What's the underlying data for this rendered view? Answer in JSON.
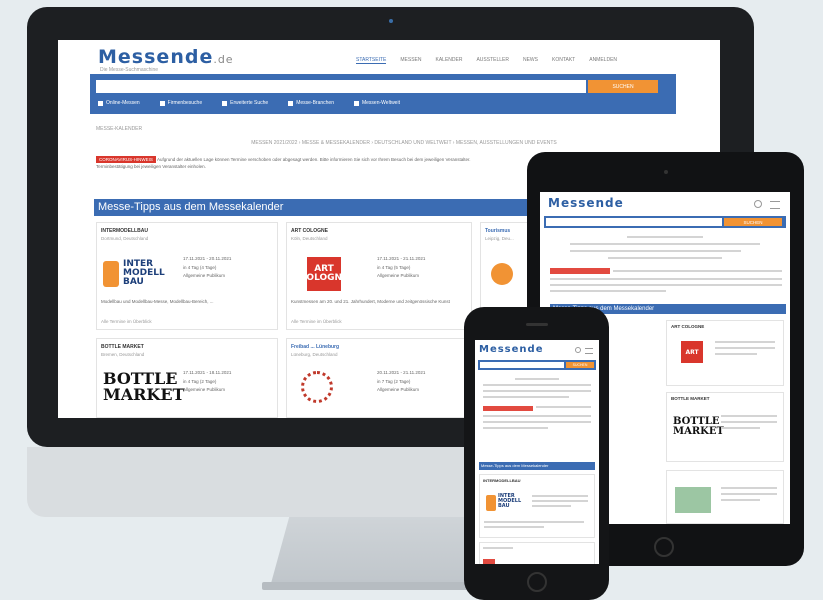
{
  "brand": {
    "logo_main": "Messe",
    "logo_suffix": "nde",
    "logo_de": ".de",
    "tagline": "Die Messe-Suchmaschine",
    "accent": "#3b6cb3",
    "orange": "#f19334",
    "red": "#d9362c"
  },
  "desktop": {
    "nav": [
      "STARTSEITE",
      "MESSEN",
      "KALENDER",
      "AUSSTELLER",
      "NEWS",
      "KONTAKT",
      "ANMELDEN"
    ],
    "search": {
      "placeholder": "",
      "button_label": "SUCHEN"
    },
    "subnav": [
      "Online-Messen",
      "Firmenbesuche",
      "Erweiterte Suche",
      "Messe-Branchen",
      "Messen-Weltweit"
    ],
    "breadcrumb": "MESSE-KALENDER",
    "headline": "MESSEN 2021/2022 › MESSE & MESSEKALENDER › DEUTSCHLAND UND WELTWEIT › MESSEN, AUSSTELLUNGEN UND EVENTS",
    "notice_badge": "CORONAVIRUS-HINWEIS",
    "notice_text": "Aufgrund der aktuellen Lage können Termine verschoben oder abgesagt werden. Bitte informieren Sie sich vor Ihrem Besuch bei dem jeweiligen Veranstalter.",
    "notice_text_2": "Terminbestätigung bei jeweiligen Veranstalter einholen.",
    "section_title": "Messe-Tipps aus dem Messekalender",
    "cards": [
      {
        "title": "INTERMODELLBAU",
        "location": "Dortmund, Deutschland",
        "date": "17.11.2021 - 20.11.2021",
        "days": "in 4 Tag (4 Tage)",
        "category": "Allgemeine Publikum",
        "desc": "Modellbau und Modellbau-Messe, Modellbau-Bereich, ...",
        "link": "Alle Termine im Überblick",
        "logo": "INTER MODELL BAU"
      },
      {
        "title": "ART COLOGNE",
        "location": "Köln, Deutschland",
        "date": "17.11.2021 - 21.11.2021",
        "days": "in 4 Tag (5 Tage)",
        "category": "Allgemeine Publikum",
        "desc": "Kunstmessen am 20. und 21. Jahrhundert, Moderne und zeitgenössische Kunst",
        "link": "Alle Termine im Überblick",
        "logo": "ART COLOGNE"
      },
      {
        "title": "Tourismus",
        "location": "Leipzig, Deu...",
        "logo": ""
      },
      {
        "title": "BOTTLE MARKET",
        "location": "Bremen, Deutschland",
        "date": "17.11.2021 - 18.11.2021",
        "days": "in 4 Tag (2 Tage)",
        "category": "Allgemeine Publikum",
        "logo": "BOTTLE MARKET"
      },
      {
        "title": "Freibad ... Lüneburg",
        "location": "Lüneburg, Deutschland",
        "date": "20.11.2021 - 21.11.2021",
        "days": "in 7 Tag (2 Tage)",
        "category": "Allgemeine Publikum",
        "logo": ""
      }
    ]
  },
  "tablet": {
    "search_button": "SUCHEN",
    "section_title": "Messe-Tipps aus dem Messekalender",
    "card_titles": [
      "ART COLOGNE",
      "BOTTLE MARKET"
    ]
  },
  "phone": {
    "search_button": "SUCHEN",
    "section_title": "Messe-Tipps aus dem Messekalender",
    "card_titles": [
      "INTERMODELLBAU"
    ]
  }
}
